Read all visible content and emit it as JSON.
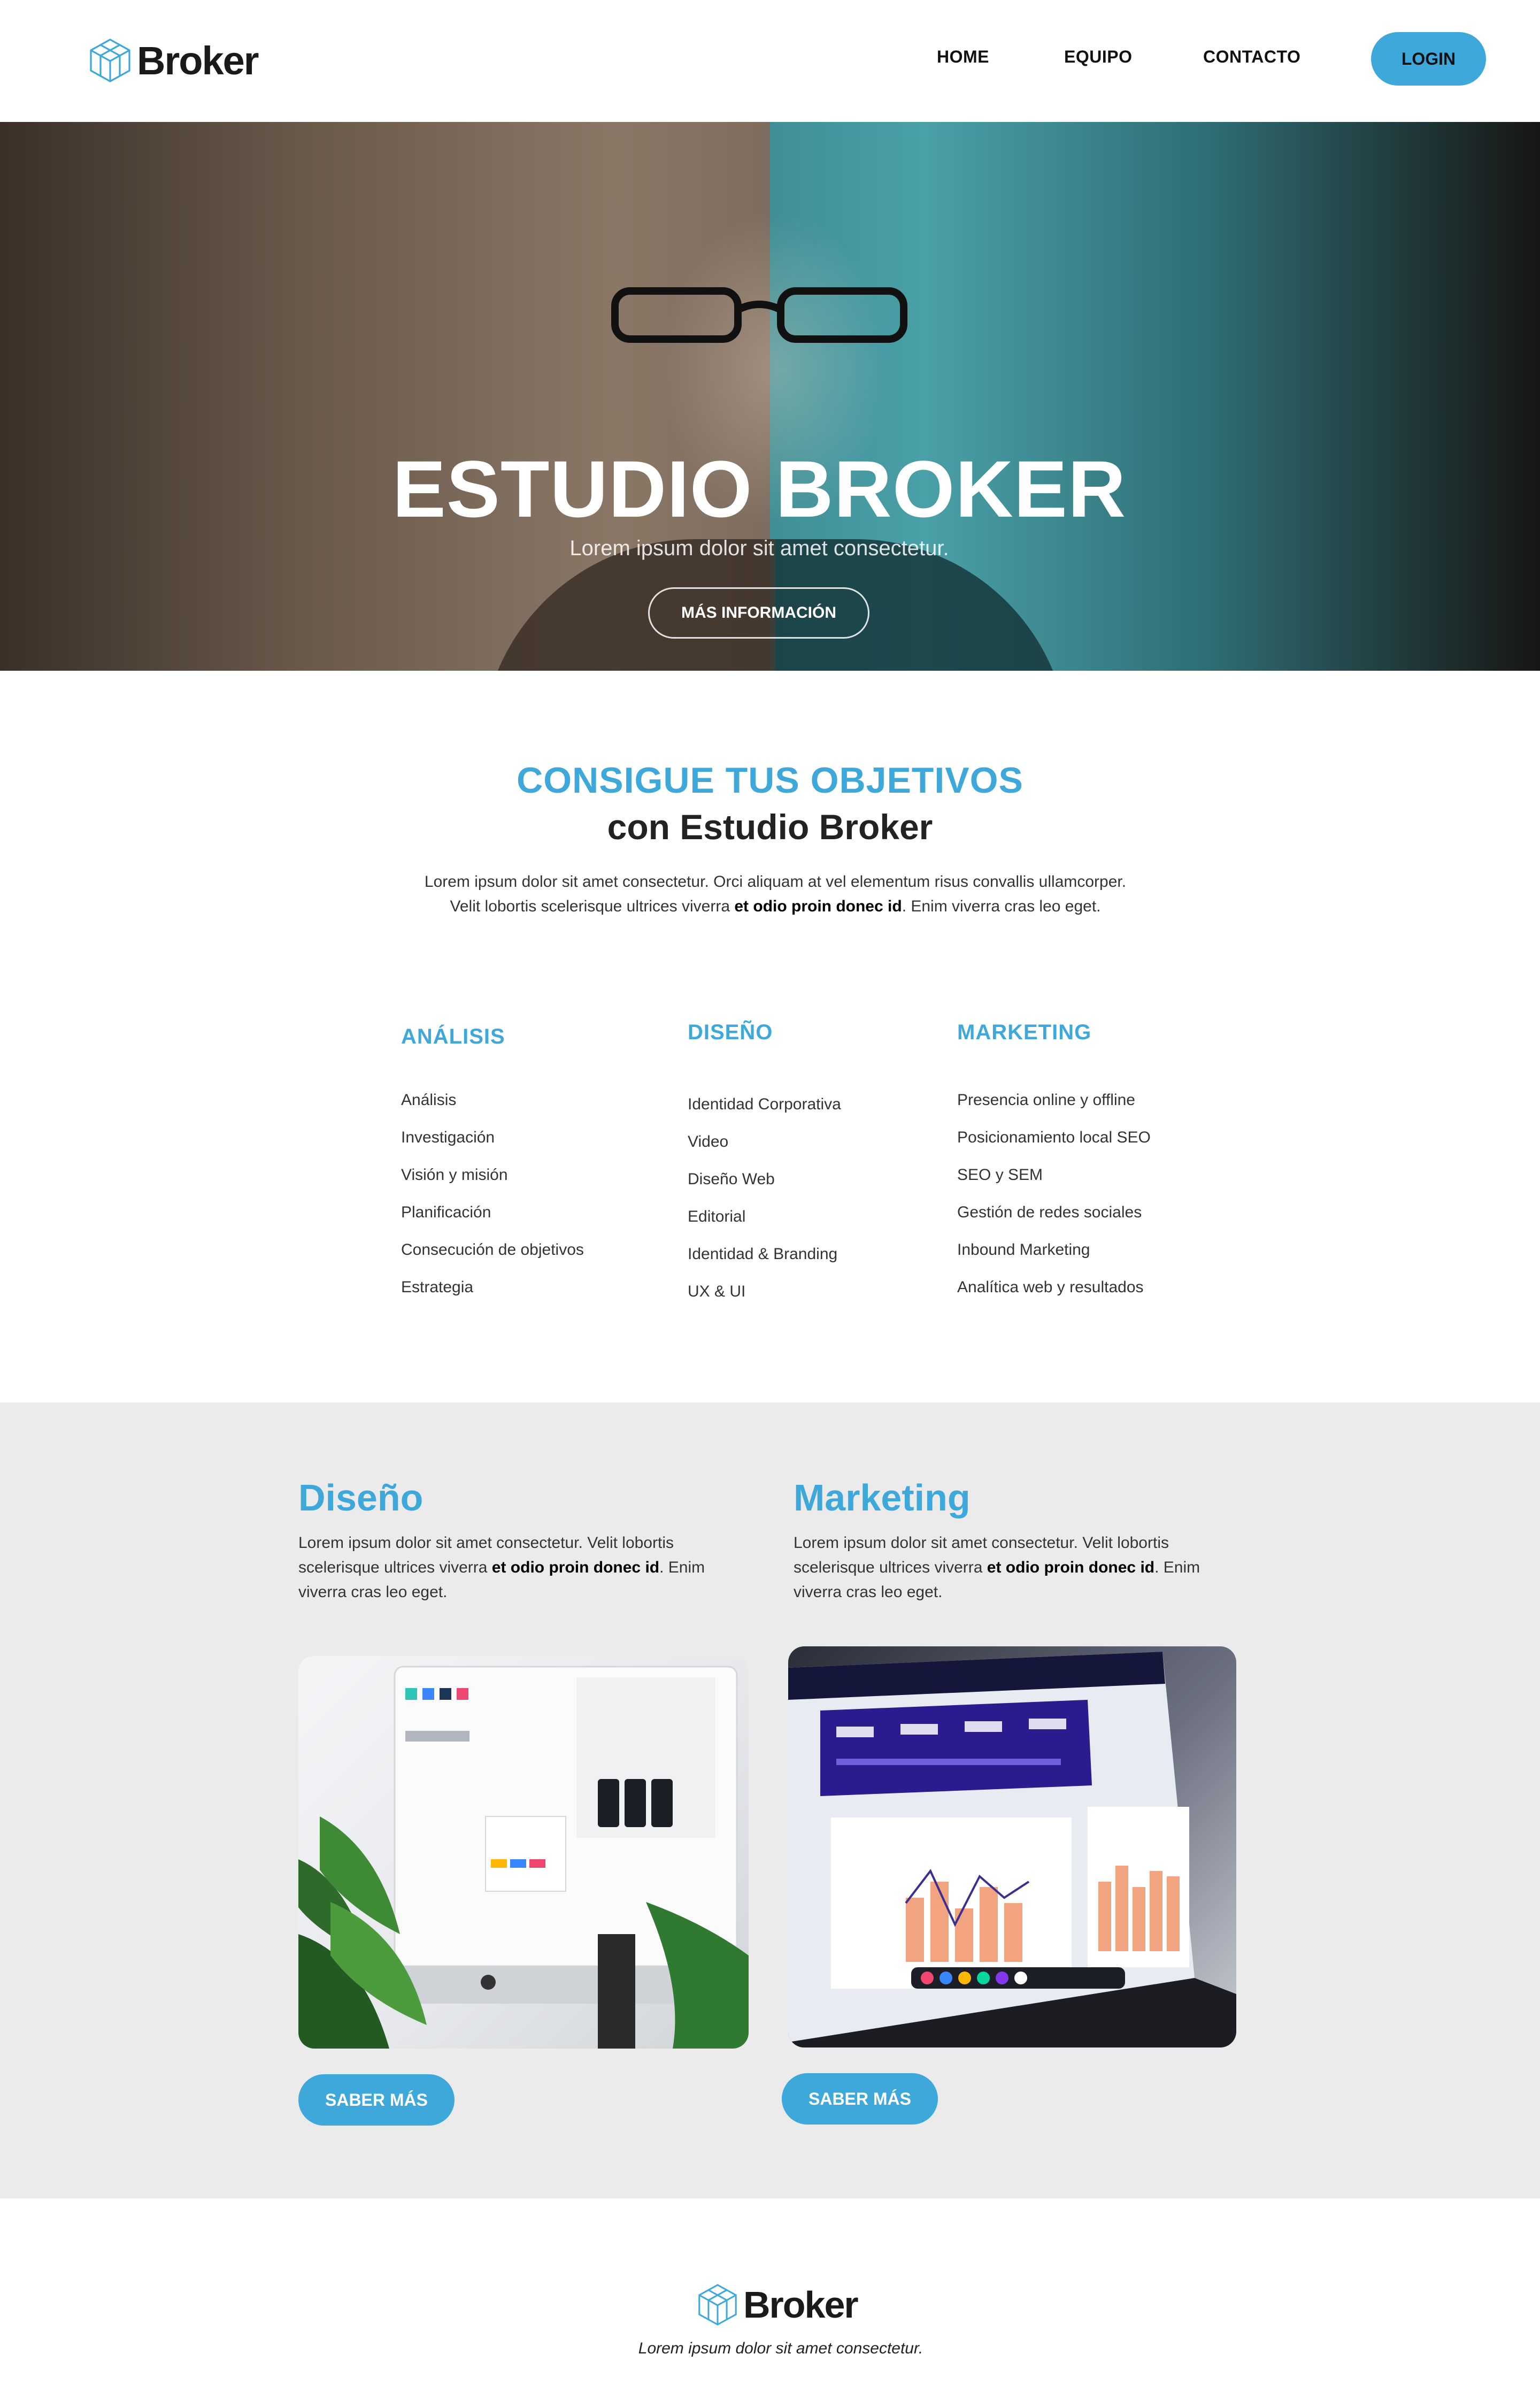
{
  "header": {
    "logo_text": "Broker",
    "nav": {
      "home": "HOME",
      "equipo": "EQUIPO",
      "contacto": "CONTACTO"
    },
    "login_label": "LOGIN"
  },
  "hero": {
    "title": "ESTUDIO BROKER",
    "subtitle": "Lorem ipsum dolor sit amet consectetur.",
    "button_label": "MÁS INFORMACIÓN"
  },
  "objetivos": {
    "title": "CONSIGUE TUS OBJETIVOS",
    "subtitle": "con Estudio Broker",
    "text_before": "Lorem ipsum dolor sit amet consectetur. Orci aliquam at vel elementum risus convallis ullamcorper. Velit lobortis scelerisque ultrices viverra ",
    "text_bold": "et odio proin donec id",
    "text_after": ". Enim viverra cras leo eget."
  },
  "services": [
    {
      "heading": "ANÁLISIS",
      "items": [
        "Análisis",
        "Investigación",
        "Visión y misión",
        "Planificación",
        "Consecución de objetivos",
        "Estrategia"
      ]
    },
    {
      "heading": "DISEÑO",
      "items": [
        "Identidad Corporativa",
        "Video",
        "Diseño Web",
        "Editorial",
        "Identidad & Branding",
        "UX & UI"
      ]
    },
    {
      "heading": "MARKETING",
      "items": [
        "Presencia online y offline",
        "Posicionamiento local SEO",
        "SEO y SEM",
        "Gestión de redes sociales",
        "Inbound Marketing",
        "Analítica web y resultados"
      ]
    }
  ],
  "cards": [
    {
      "title": "Diseño",
      "text_before": "Lorem ipsum dolor sit amet consectetur. Velit lobortis scelerisque ultrices viverra ",
      "text_bold": "et odio proin donec id",
      "text_after": ". Enim viverra cras leo eget.",
      "button_label": "SABER MÁS"
    },
    {
      "title": "Marketing",
      "text_before": "Lorem ipsum dolor sit amet consectetur. Velit lobortis scelerisque ultrices viverra ",
      "text_bold": "et odio proin donec id",
      "text_after": ". Enim viverra cras leo eget.",
      "button_label": "SABER MÁS"
    }
  ],
  "footer": {
    "logo_text": "Broker",
    "tagline": "Lorem ipsum dolor sit amet consectetur."
  },
  "colors": {
    "accent": "#3ea8da",
    "grey_bg": "#ebebeb",
    "text": "#333333"
  },
  "icons": {
    "logo": "cube-outline-icon"
  }
}
